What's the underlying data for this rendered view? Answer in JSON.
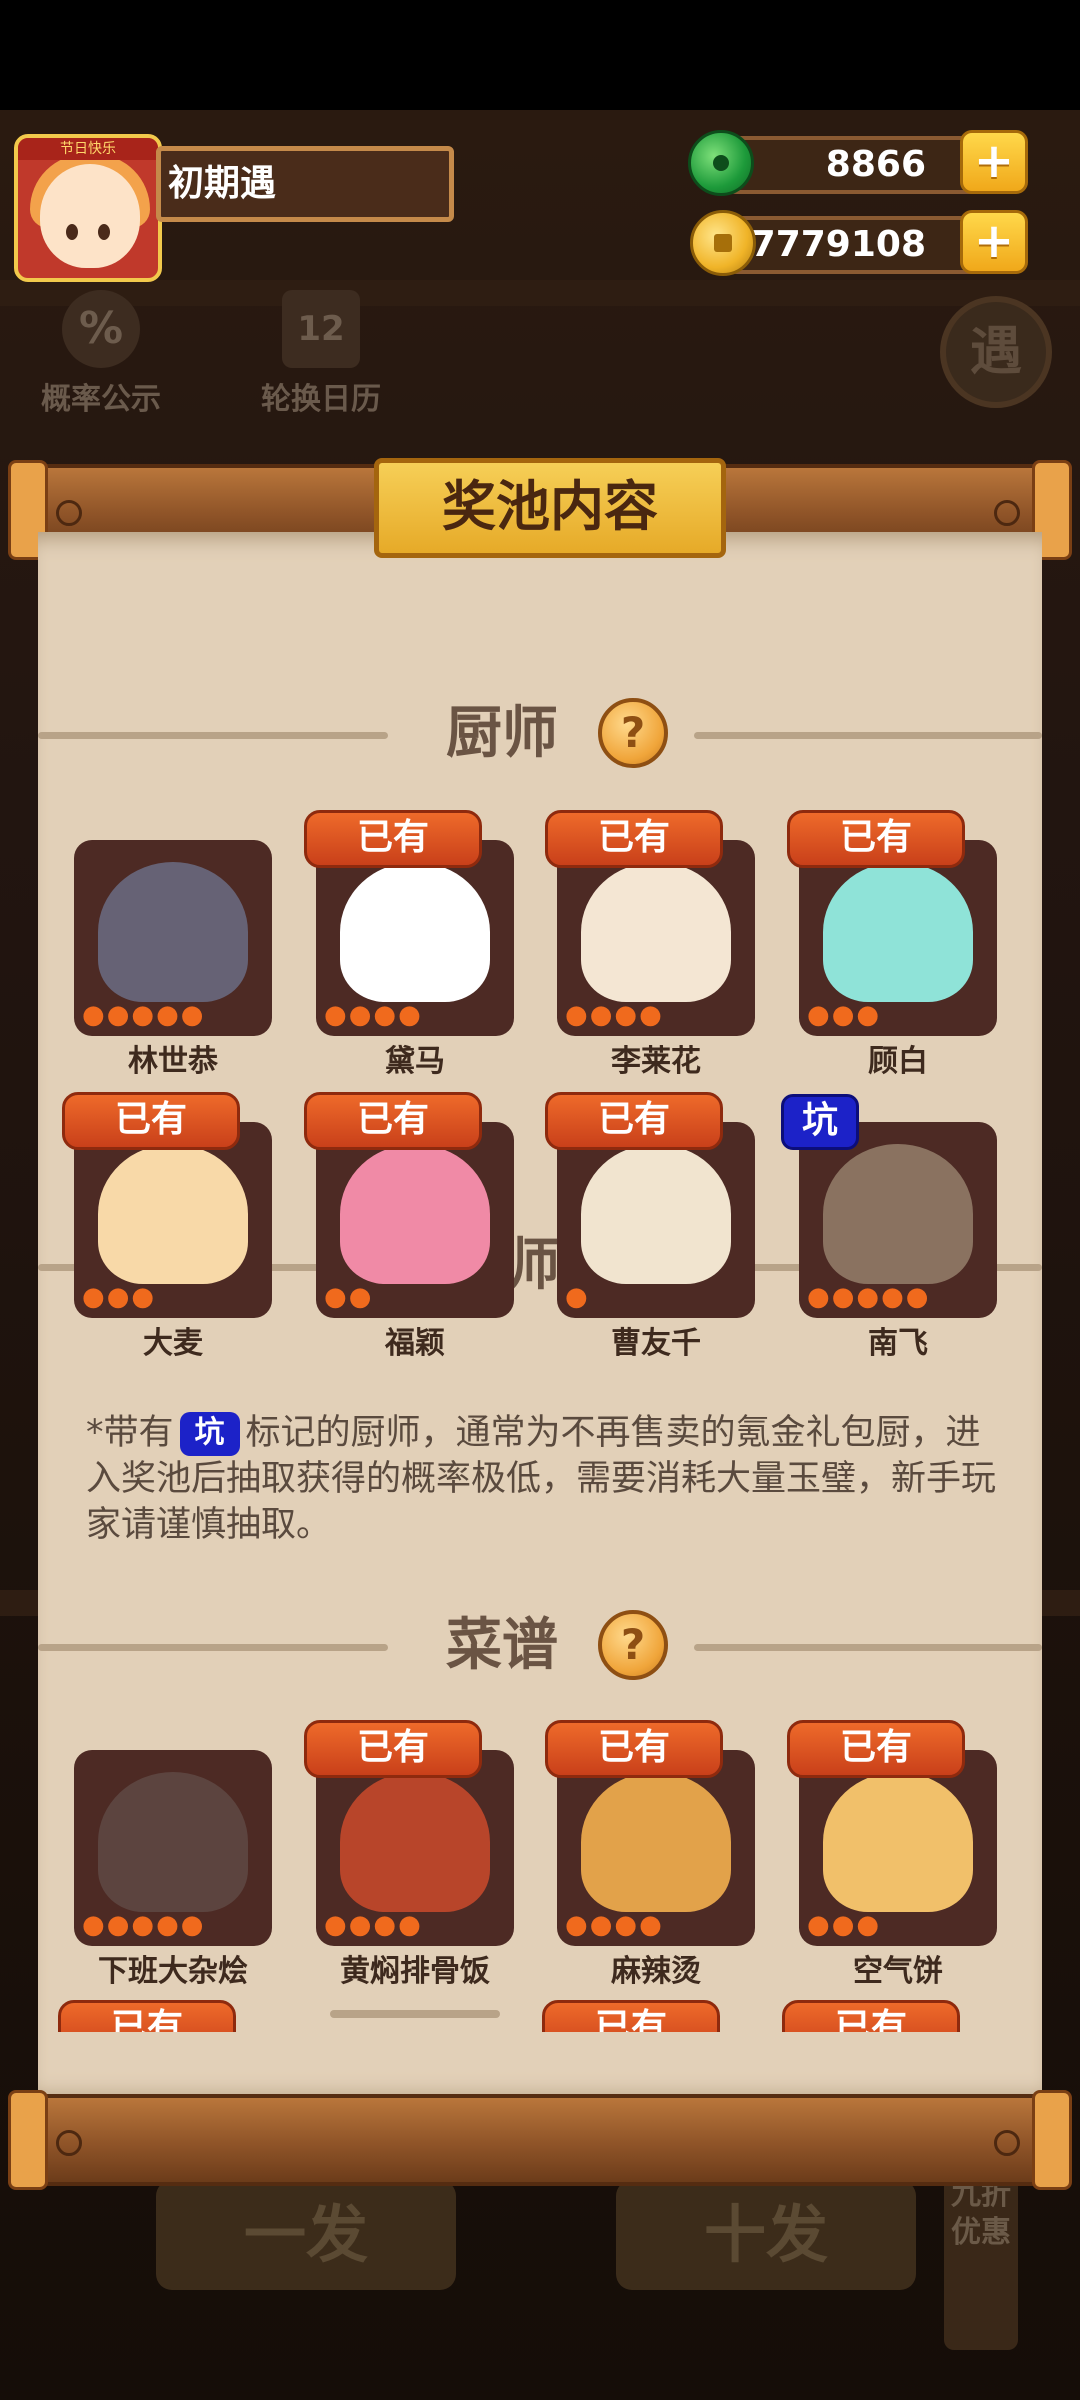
{
  "player": {
    "name": "初期遇",
    "avatar_banner": "节日快乐"
  },
  "currency": {
    "jade": "8866",
    "coins": "7779108"
  },
  "background": {
    "quick_actions": [
      {
        "label": "概率公示",
        "icon": "%"
      },
      {
        "label": "轮换日历",
        "icon": "12"
      }
    ],
    "meet_label": "遇",
    "draw_single": "一发",
    "draw_ten": "十发",
    "discount": "九折优惠"
  },
  "panel": {
    "title": "奖池内容",
    "chef_section": {
      "title": "厨师",
      "help_icon": "?",
      "owned_label": "已有",
      "pit_label": "坑",
      "items": [
        {
          "name": "林世恭",
          "owned": false,
          "pit": false,
          "stars": 5,
          "color": "#7b8fb8"
        },
        {
          "name": "黛马",
          "owned": true,
          "pit": false,
          "stars": 4,
          "color": "#ffffff"
        },
        {
          "name": "李莱花",
          "owned": true,
          "pit": false,
          "stars": 4,
          "color": "#f4e6d3"
        },
        {
          "name": "顾白",
          "owned": true,
          "pit": false,
          "stars": 3,
          "color": "#8fe3d8"
        },
        {
          "name": "大麦",
          "owned": true,
          "pit": false,
          "stars": 3,
          "color": "#f8d9a8"
        },
        {
          "name": "福颖",
          "owned": true,
          "pit": false,
          "stars": 2,
          "color": "#f08aa6"
        },
        {
          "name": "曹友千",
          "owned": true,
          "pit": false,
          "stars": 1,
          "color": "#f1e4cf"
        },
        {
          "name": "南飞",
          "owned": false,
          "pit": true,
          "stars": 5,
          "color": "#8a7260"
        }
      ],
      "note_before": "*带有",
      "note_after": "标记的厨师，通常为不再售卖的氪金礼包厨，进入奖池后抽取获得的概率极低，需要消耗大量玉璧，新手玩家请谨慎抽取。"
    },
    "recipe_section": {
      "title": "菜谱",
      "help_icon": "?",
      "owned_label": "已有",
      "items": [
        {
          "name": "下班大杂烩",
          "owned": false,
          "stars": 5,
          "color": "#6a5a55"
        },
        {
          "name": "黄焖排骨饭",
          "owned": true,
          "stars": 4,
          "color": "#b8452a"
        },
        {
          "name": "麻辣烫",
          "owned": true,
          "stars": 4,
          "color": "#e2a24a"
        },
        {
          "name": "空气饼",
          "owned": true,
          "stars": 3,
          "color": "#f1c06a"
        }
      ]
    }
  }
}
